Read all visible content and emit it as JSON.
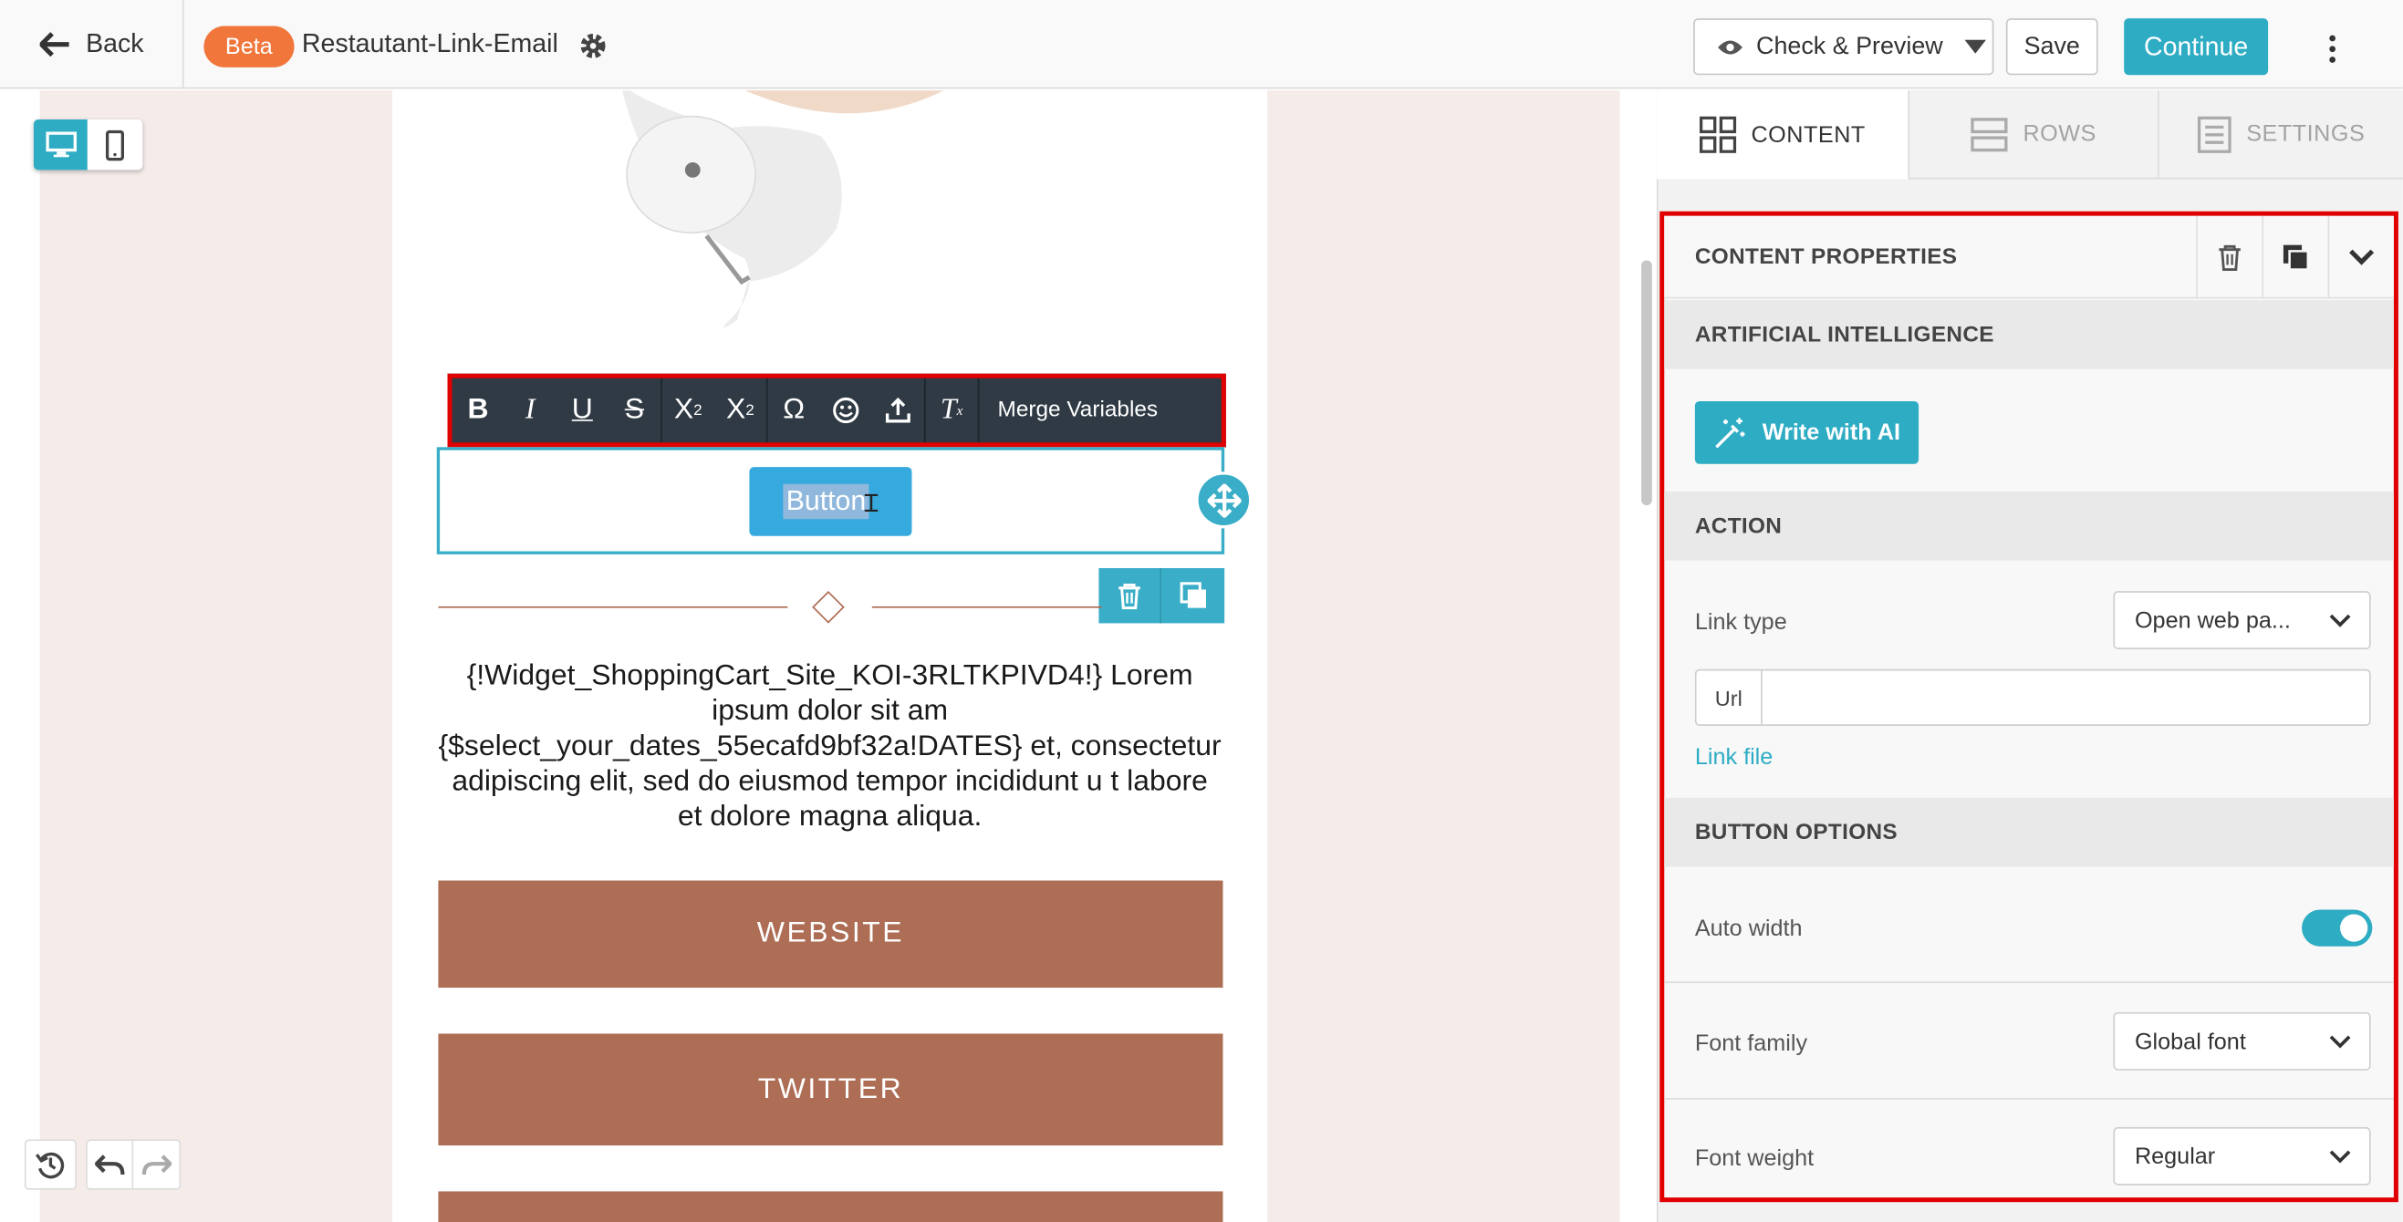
{
  "topbar": {
    "back_label": "Back",
    "beta_badge": "Beta",
    "document_title": "Restautant-Link-Email",
    "check_preview_label": "Check & Preview",
    "save_label": "Save",
    "continue_label": "Continue"
  },
  "editor": {
    "toolbar": {
      "merge_variables_label": "Merge Variables"
    },
    "button_label": "Button",
    "body_text": "{!Widget_ShoppingCart_Site_KOI-3RLTKPIVD4!} Lorem ipsum dolor sit am {$select_your_dates_55ecafd9bf32a!DATES} et, consectetur adipiscing elit, sed do eiusmod tempor incididunt u t labore et dolore magna aliqua.",
    "social_buttons": [
      "WEBSITE",
      "TWITTER"
    ]
  },
  "panel": {
    "tabs": [
      {
        "label": "CONTENT",
        "active": true
      },
      {
        "label": "ROWS",
        "active": false
      },
      {
        "label": "SETTINGS",
        "active": false
      }
    ],
    "content_properties_title": "CONTENT PROPERTIES",
    "ai_section_title": "ARTIFICIAL INTELLIGENCE",
    "write_ai_label": "Write with AI",
    "action_section_title": "ACTION",
    "link_type_label": "Link type",
    "link_type_value": "Open web pa...",
    "url_label": "Url",
    "url_value": "",
    "link_file_label": "Link file",
    "button_options_title": "BUTTON OPTIONS",
    "auto_width_label": "Auto width",
    "auto_width_on": true,
    "font_family_label": "Font family",
    "font_family_value": "Global font",
    "font_weight_label": "Font weight",
    "font_weight_value": "Regular"
  },
  "colors": {
    "accent": "#2eacc4",
    "beta": "#f0763b",
    "social_button": "#ad6e55",
    "highlight_border": "#e00000"
  }
}
